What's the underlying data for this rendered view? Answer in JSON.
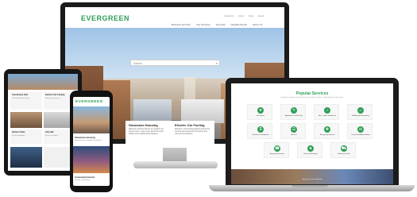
{
  "desktop": {
    "logo": "EVERGREEN",
    "nav": [
      "Business and Dev",
      "City Services",
      "Get Help",
      "Neighborhoods",
      "About Us"
    ],
    "top_links": [
      "Contact Us",
      "Alerts",
      "News",
      "Events"
    ],
    "search_placeholder": "Search"
  },
  "feature_cards": [
    {
      "title": "Showcase Housing",
      "text": "Welcome. Browse homes of excellent city sites we love. Learn more about the local market and neighbourhood guides."
    },
    {
      "title": "Electric Car Fueling",
      "text": "Welcome. Find fueling stations across the city and learn about EV incentives and community programs."
    },
    {
      "title": "Historic Sites",
      "text": "Welcome. Discover the history behind landmarks and plan a visit to local museums."
    }
  ],
  "tablet": {
    "items": [
      {
        "title": "Community Hub",
        "text": "Latest updates from the city"
      },
      {
        "title": "Electric Car Fueling",
        "text": "Stations and incentives"
      },
      {
        "title": "Historic Sites",
        "text": "Visit local landmarks"
      },
      {
        "title": "City Hall",
        "text": "Services and offices"
      }
    ]
  },
  "phone": {
    "logo": "EVERGREEN",
    "items": [
      {
        "title": "Showcase Housing",
        "text": "Browse homes and neighbourhood guides"
      },
      {
        "title": "Community Events",
        "text": "Festivals and gatherings"
      }
    ]
  },
  "laptop": {
    "services_title": "Popular Services",
    "services_subtitle": "Find quick answers and city services in one place. Select a category below to get started.",
    "services": [
      {
        "label": "Recreation",
        "icon": "★"
      },
      {
        "label": "Applications and Permits",
        "icon": "✎"
      },
      {
        "label": "Arts, Culture and Events",
        "icon": "♪"
      },
      {
        "label": "Building and Renovating",
        "icon": "⌂"
      },
      {
        "label": "Economic Development",
        "icon": "$"
      },
      {
        "label": "Services",
        "icon": "☰"
      },
      {
        "label": "Emergency Services",
        "icon": "✚"
      },
      {
        "label": "Council and Administration",
        "icon": "⚖"
      },
      {
        "label": "Emergency Services",
        "icon": "☎"
      },
      {
        "label": "Parks and Property",
        "icon": "♣"
      },
      {
        "label": "Roads and Traffic",
        "icon": "⛟"
      }
    ],
    "footer_text": "Sign up for our newsletter"
  },
  "colors": {
    "brand_green": "#2f9e57",
    "device_frame": "#1b1b1b"
  }
}
